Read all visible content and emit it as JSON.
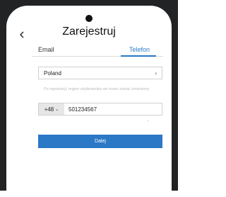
{
  "header": {
    "title": "Zarejestruj",
    "back_icon": "chevron-left-icon"
  },
  "tabs": [
    {
      "label": "Email",
      "active": false
    },
    {
      "label": "Telefon",
      "active": true
    }
  ],
  "country": {
    "value": "Poland",
    "chevron": "›"
  },
  "hint": "Po rejestracji, region użytkownika nie może zostać zmieniony",
  "phone": {
    "prefix": "+48",
    "prefix_chevron": "⌄",
    "value": "501234567"
  },
  "primary_button": {
    "label": "Dalej"
  },
  "colors": {
    "accent": "#2a78c6",
    "bezel": "#222324"
  }
}
